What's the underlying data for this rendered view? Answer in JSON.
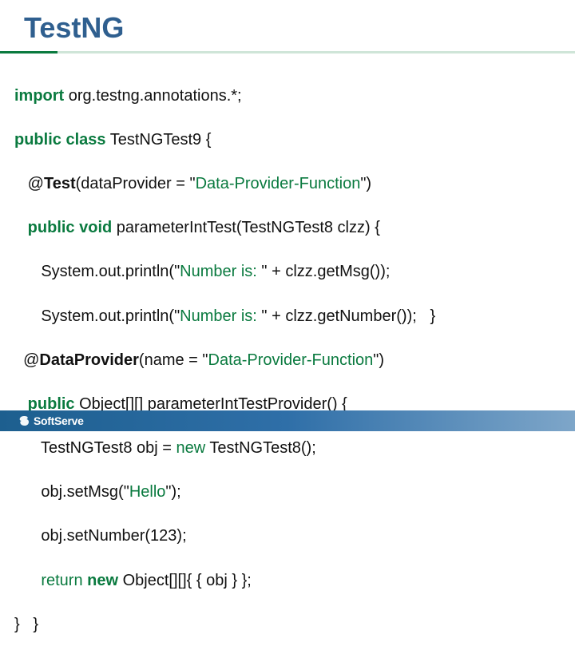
{
  "title": "TestNG",
  "code": {
    "l1_import": "import",
    "l1_rest": " org.testng.annotations.*;",
    "l2_pubclass": "public class",
    "l2_rest": " TestNGTest9 {",
    "l3_at": "   @",
    "l3_test": "Test",
    "l3_open": "(dataProvider = \"",
    "l3_dp": "Data-Provider-Function",
    "l3_close": "\")",
    "l4_ind": "   ",
    "l4_pv": "public void",
    "l4_rest": " parameterIntTest(TestNGTest8 clzz) {",
    "l5_prefix": "      System.out.println(\"",
    "l5_str": "Number is: ",
    "l5_suffix": "\" + clzz.getMsg());",
    "l6_prefix": "      System.out.println(\"",
    "l6_str": "Number is: ",
    "l6_suffix": "\" + clzz.getNumber());   }",
    "l7_at": "  @",
    "l7_dp": "DataProvider",
    "l7_open": "(name = \"",
    "l7_dpname": "Data-Provider-Function",
    "l7_close": "\")",
    "l8_ind": "   ",
    "l8_public": "public",
    "l8_rest": " Object[][] parameterIntTestProvider() {",
    "l9_prefix": "      TestNGTest8 obj = ",
    "l9_new": "new",
    "l9_suffix": " TestNGTest8();",
    "l10_prefix": "      obj.setMsg(\"",
    "l10_str": "Hello",
    "l10_suffix": "\");",
    "l11": "      obj.setNumber(123);",
    "l12_ind": "      ",
    "l12_return": "return",
    "l12_sp": " ",
    "l12_new": "new",
    "l12_suffix": " Object[][]{ { obj } };",
    "l13": "}   }"
  },
  "footer": "SoftServe"
}
